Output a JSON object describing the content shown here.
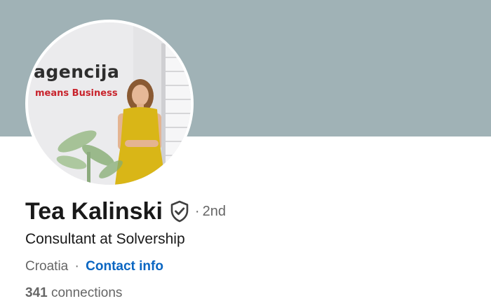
{
  "profile": {
    "name": "Tea Kalinski",
    "degree_separator": "·",
    "connection_degree": "2nd",
    "headline": "Consultant at Solvership",
    "location": "Croatia",
    "location_separator": "·",
    "contact_info_label": "Contact info",
    "connections_count": "341",
    "connections_label": "connections",
    "verified_icon": "shield-check-icon"
  },
  "avatar_photo": {
    "wordmark": "agencija",
    "tagline": "means Business"
  },
  "colors": {
    "banner": "#a0b2b6",
    "link": "#0a66c2",
    "text_primary": "#191919",
    "text_secondary": "#666666",
    "tagline_red": "#c8232c",
    "dress_yellow": "#d9b617"
  }
}
